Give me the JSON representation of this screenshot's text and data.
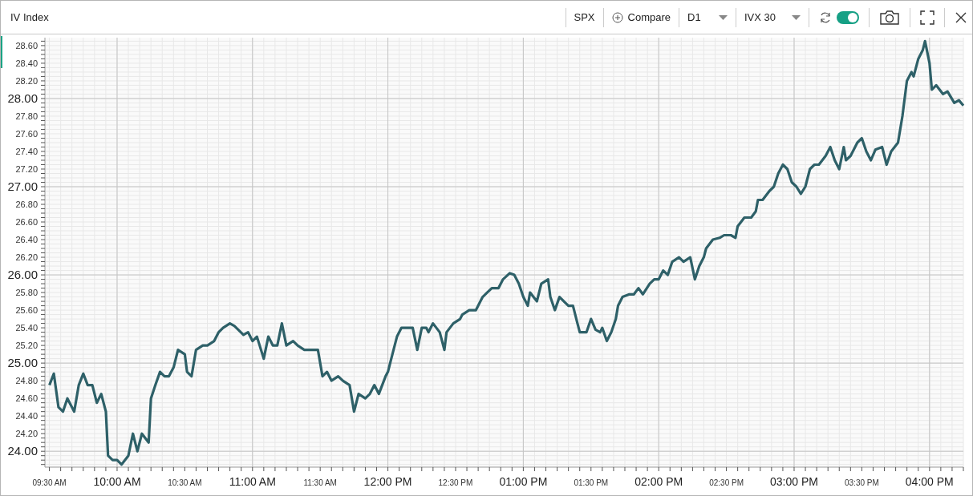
{
  "window": {
    "title": "IV Index"
  },
  "toolbar": {
    "symbol": "SPX",
    "compare": "Compare",
    "period": "D1",
    "measure": "IVX 30",
    "auto_refresh": {
      "on": true
    }
  },
  "chart": {
    "chart_data": {
      "type": "line",
      "grid": true,
      "xlim": [
        9.467,
        16.25
      ],
      "ylim": [
        23.82,
        28.69
      ],
      "xticks": [
        {
          "value": 9.5,
          "label": "09:30 AM"
        },
        {
          "value": 10,
          "label": "10:00 AM"
        },
        {
          "value": 10.5,
          "label": "10:30 AM"
        },
        {
          "value": 11,
          "label": "11:00 AM"
        },
        {
          "value": 11.5,
          "label": "11:30 AM"
        },
        {
          "value": 12,
          "label": "12:00 PM"
        },
        {
          "value": 12.5,
          "label": "12:30 PM"
        },
        {
          "value": 13,
          "label": "01:00 PM"
        },
        {
          "value": 13.5,
          "label": "01:30 PM"
        },
        {
          "value": 14,
          "label": "02:00 PM"
        },
        {
          "value": 14.5,
          "label": "02:30 PM"
        },
        {
          "value": 15,
          "label": "03:00 PM"
        },
        {
          "value": 15.5,
          "label": "03:30 PM"
        },
        {
          "value": 16,
          "label": "04:00 PM"
        }
      ],
      "yticks": [
        {
          "value": 24,
          "label": "24.00"
        },
        {
          "value": 24.2,
          "label": "24.20"
        },
        {
          "value": 24.4,
          "label": "24.40"
        },
        {
          "value": 24.6,
          "label": "24.60"
        },
        {
          "value": 24.8,
          "label": "24.80"
        },
        {
          "value": 25,
          "label": "25.00"
        },
        {
          "value": 25.2,
          "label": "25.20"
        },
        {
          "value": 25.4,
          "label": "25.40"
        },
        {
          "value": 25.6,
          "label": "25.60"
        },
        {
          "value": 25.8,
          "label": "25.80"
        },
        {
          "value": 26,
          "label": "26.00"
        },
        {
          "value": 26.2,
          "label": "26.20"
        },
        {
          "value": 26.4,
          "label": "26.40"
        },
        {
          "value": 26.6,
          "label": "26.60"
        },
        {
          "value": 26.8,
          "label": "26.80"
        },
        {
          "value": 27,
          "label": "27.00"
        },
        {
          "value": 27.2,
          "label": "27.20"
        },
        {
          "value": 27.4,
          "label": "27.40"
        },
        {
          "value": 27.6,
          "label": "27.60"
        },
        {
          "value": 27.8,
          "label": "27.80"
        },
        {
          "value": 28,
          "label": "28.00"
        },
        {
          "value": 28.2,
          "label": "28.20"
        },
        {
          "value": 28.4,
          "label": "28.40"
        },
        {
          "value": 28.6,
          "label": "28.60"
        }
      ],
      "x": [
        9.5,
        9.533,
        9.567,
        9.6,
        9.633,
        9.683,
        9.717,
        9.75,
        9.783,
        9.817,
        9.85,
        9.883,
        9.917,
        9.933,
        9.967,
        10,
        10.033,
        10.083,
        10.117,
        10.15,
        10.183,
        10.233,
        10.25,
        10.283,
        10.317,
        10.35,
        10.383,
        10.417,
        10.45,
        10.5,
        10.517,
        10.55,
        10.583,
        10.633,
        10.667,
        10.717,
        10.75,
        10.783,
        10.833,
        10.867,
        10.933,
        10.967,
        11,
        11.033,
        11.083,
        11.117,
        11.15,
        11.183,
        11.217,
        11.25,
        11.3,
        11.333,
        11.383,
        11.433,
        11.483,
        11.517,
        11.55,
        11.583,
        11.633,
        11.667,
        11.717,
        11.75,
        11.783,
        11.833,
        11.867,
        11.9,
        11.933,
        11.983,
        12,
        12.033,
        12.067,
        12.1,
        12.15,
        12.183,
        12.217,
        12.25,
        12.283,
        12.3,
        12.333,
        12.383,
        12.417,
        12.433,
        12.483,
        12.533,
        12.55,
        12.6,
        12.65,
        12.7,
        12.733,
        12.767,
        12.817,
        12.85,
        12.9,
        12.933,
        12.967,
        13,
        13.033,
        13.05,
        13.1,
        13.133,
        13.183,
        13.2,
        13.233,
        13.267,
        13.3,
        13.333,
        13.367,
        13.4,
        13.417,
        13.467,
        13.5,
        13.533,
        13.567,
        13.583,
        13.617,
        13.65,
        13.683,
        13.7,
        13.733,
        13.783,
        13.817,
        13.85,
        13.883,
        13.933,
        13.967,
        14,
        14.033,
        14.067,
        14.1,
        14.15,
        14.183,
        14.233,
        14.267,
        14.3,
        14.333,
        14.35,
        14.4,
        14.45,
        14.483,
        14.533,
        14.567,
        14.583,
        14.633,
        14.683,
        14.717,
        14.733,
        14.767,
        14.817,
        14.85,
        14.883,
        14.917,
        14.95,
        14.983,
        15.017,
        15.05,
        15.083,
        15.117,
        15.15,
        15.183,
        15.233,
        15.267,
        15.3,
        15.333,
        15.367,
        15.383,
        15.417,
        15.467,
        15.5,
        15.533,
        15.567,
        15.6,
        15.65,
        15.683,
        15.717,
        15.767,
        15.8,
        15.833,
        15.867,
        15.883,
        15.917,
        15.95,
        15.967,
        16,
        16.017,
        16.05,
        16.1,
        16.133,
        16.183,
        16.217,
        16.25
      ],
      "series": [
        {
          "color": "#2e6068",
          "values": [
            24.75,
            24.88,
            24.5,
            24.45,
            24.6,
            24.45,
            24.75,
            24.88,
            24.75,
            24.75,
            24.55,
            24.65,
            24.45,
            23.95,
            23.9,
            23.9,
            23.85,
            23.95,
            24.2,
            24.0,
            24.2,
            24.1,
            24.6,
            24.75,
            24.9,
            24.85,
            24.85,
            24.95,
            25.15,
            25.1,
            24.9,
            24.85,
            25.15,
            25.2,
            25.2,
            25.25,
            25.35,
            25.4,
            25.45,
            25.42,
            25.32,
            25.35,
            25.25,
            25.3,
            25.05,
            25.3,
            25.2,
            25.2,
            25.45,
            25.2,
            25.25,
            25.2,
            25.15,
            25.15,
            25.15,
            24.85,
            24.9,
            24.8,
            24.85,
            24.8,
            24.75,
            24.45,
            24.65,
            24.6,
            24.65,
            24.75,
            24.65,
            24.85,
            24.9,
            25.1,
            25.3,
            25.4,
            25.4,
            25.4,
            25.15,
            25.4,
            25.4,
            25.35,
            25.45,
            25.35,
            25.15,
            25.35,
            25.45,
            25.5,
            25.55,
            25.6,
            25.6,
            25.75,
            25.8,
            25.85,
            25.85,
            25.95,
            26.02,
            26.0,
            25.9,
            25.75,
            25.65,
            25.8,
            25.7,
            25.9,
            25.95,
            25.75,
            25.6,
            25.75,
            25.7,
            25.65,
            25.65,
            25.45,
            25.35,
            25.35,
            25.5,
            25.38,
            25.35,
            25.4,
            25.25,
            25.35,
            25.5,
            25.65,
            25.75,
            25.78,
            25.78,
            25.85,
            25.78,
            25.9,
            25.95,
            25.95,
            26.05,
            26.0,
            26.15,
            26.2,
            26.15,
            26.2,
            25.95,
            26.1,
            26.2,
            26.3,
            26.4,
            26.42,
            26.45,
            26.45,
            26.42,
            26.55,
            26.65,
            26.65,
            26.72,
            26.85,
            26.85,
            26.95,
            27.0,
            27.15,
            27.25,
            27.2,
            27.05,
            27.0,
            26.92,
            27.0,
            27.2,
            27.25,
            27.25,
            27.35,
            27.45,
            27.3,
            27.2,
            27.45,
            27.3,
            27.35,
            27.5,
            27.55,
            27.4,
            27.3,
            27.42,
            27.45,
            27.25,
            27.4,
            27.5,
            27.8,
            28.2,
            28.3,
            28.25,
            28.45,
            28.55,
            28.65,
            28.4,
            28.1,
            28.15,
            28.05,
            28.08,
            27.95,
            27.98,
            27.92
          ]
        }
      ]
    }
  }
}
